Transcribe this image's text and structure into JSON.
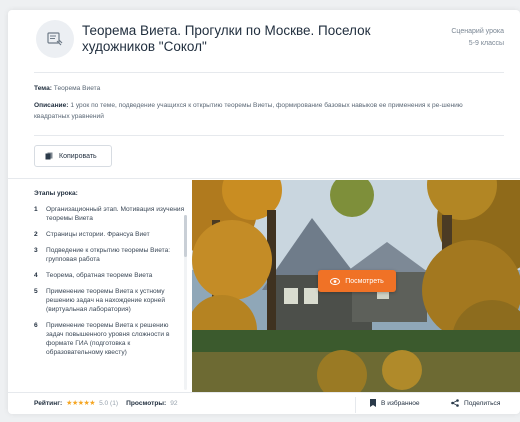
{
  "header": {
    "title": "Теорема Виета. Прогулки по Москве. Поселок художников \"Сокол\"",
    "type": "Сценарий урока",
    "grades": "5-9 классы"
  },
  "info": {
    "topic_label": "Тема:",
    "topic": "Теорема Виета",
    "desc_label": "Описание:",
    "desc": "1 урок по теме, подведение учащихся к открытию теоремы Виеты, формирование базовых навыков ее применения к ре-шению квадратных уравнений"
  },
  "copy_button": "Копировать",
  "stages": {
    "title": "Этапы урока:",
    "items": [
      {
        "num": "1",
        "text": "Организационный этап. Мотивация изучения теоремы Виета"
      },
      {
        "num": "2",
        "text": "Страницы истории. Франсуа Виет"
      },
      {
        "num": "3",
        "text": "Подведение к открытию теоремы Виета: групповая работа"
      },
      {
        "num": "4",
        "text": "Теорема, обратная теореме Виета"
      },
      {
        "num": "5",
        "text": "Применение теоремы Виета к устному решению задач на нахождение корней (виртуальная лаборатория)"
      },
      {
        "num": "6",
        "text": "Применение теоремы Виета к решению задач повышенного уровня сложности в формате ГИА (подготовка к образовательному квесту)"
      }
    ]
  },
  "photo": {
    "view_button": "Посмотреть"
  },
  "footer": {
    "rating_label": "Рейтинг:",
    "stars": "★★★★★",
    "rating_value": "5.0 (1)",
    "views_label": "Просмотры:",
    "views_value": "92",
    "favorite": "В избранное",
    "share": "Поделиться"
  },
  "colors": {
    "accent": "#f07226",
    "star": "#f5a623"
  },
  "icons": [
    "scenario-icon",
    "copy-icon",
    "eye-icon",
    "bookmark-icon",
    "share-icon"
  ]
}
